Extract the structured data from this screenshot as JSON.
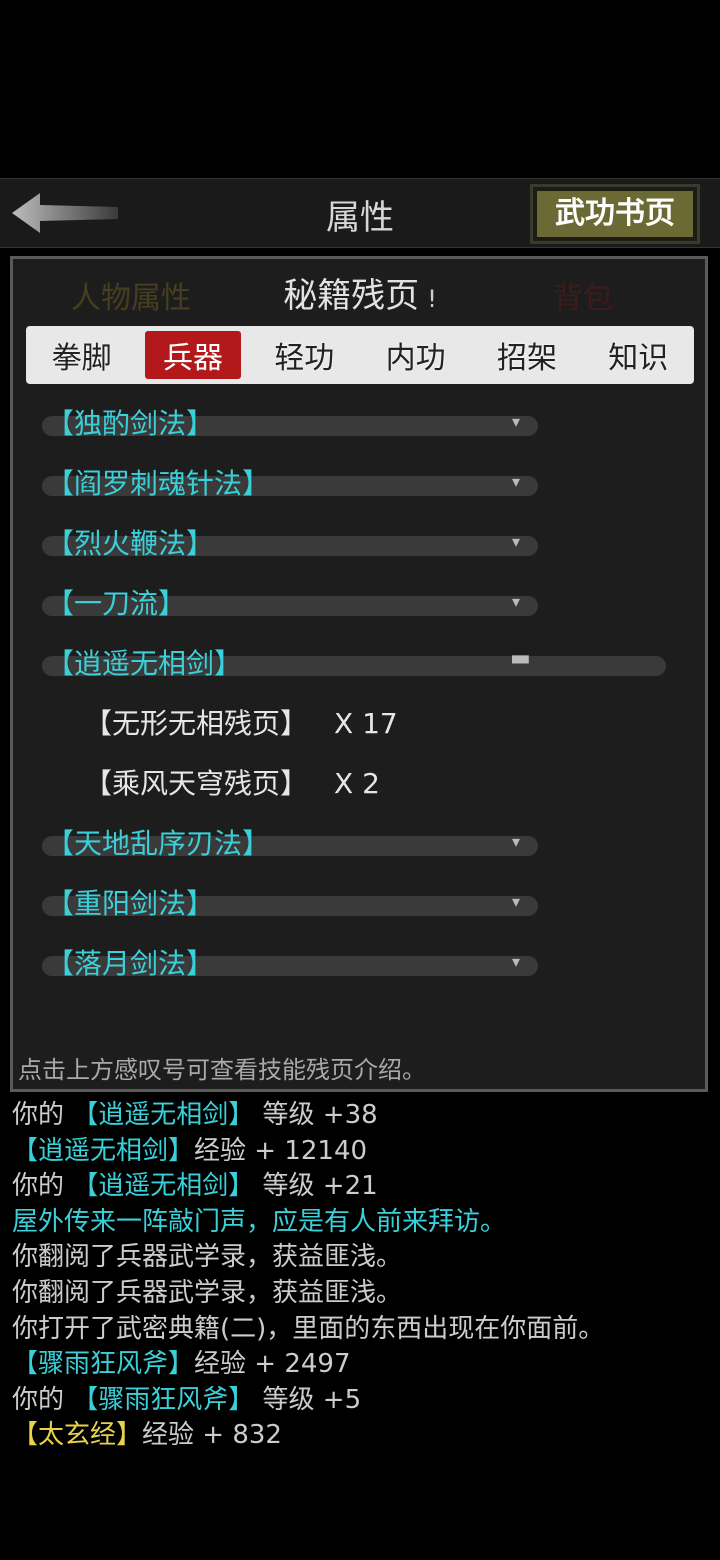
{
  "header": {
    "title": "属性",
    "back_icon": "back-arrow-icon",
    "action_button": "武功书页"
  },
  "background_panel": {
    "left_tab": "人物属性",
    "right_tab": "背包"
  },
  "modal": {
    "title": "秘籍残页",
    "info_mark": "!",
    "tabs": [
      {
        "label": "拳脚",
        "active": false
      },
      {
        "label": "兵器",
        "active": true
      },
      {
        "label": "轻功",
        "active": false
      },
      {
        "label": "内功",
        "active": false
      },
      {
        "label": "招架",
        "active": false
      },
      {
        "label": "知识",
        "active": false
      }
    ],
    "groups": [
      {
        "name": "【独酌剑法】",
        "state": "collapsed"
      },
      {
        "name": "【阎罗刺魂针法】",
        "state": "collapsed"
      },
      {
        "name": "【烈火鞭法】",
        "state": "collapsed"
      },
      {
        "name": "【一刀流】",
        "state": "collapsed"
      },
      {
        "name": "【逍遥无相剑】",
        "state": "expanded",
        "items": [
          {
            "name": "【无形无相残页】",
            "qty": "X 17"
          },
          {
            "name": "【乘风天穹残页】",
            "qty": "X 2"
          }
        ]
      },
      {
        "name": "【天地乱序刃法】",
        "state": "collapsed"
      },
      {
        "name": "【重阳剑法】",
        "state": "collapsed"
      },
      {
        "name": "【落月剑法】",
        "state": "collapsed"
      }
    ],
    "hint": "点击上方感叹号可查看技能残页介绍。"
  },
  "log": [
    [
      {
        "t": "你的 ",
        "c": ""
      },
      {
        "t": "【逍遥无相剑】",
        "c": "cyan"
      },
      {
        "t": " 等级 +38",
        "c": ""
      }
    ],
    [
      {
        "t": "【逍遥无相剑】",
        "c": "cyan"
      },
      {
        "t": "经验 + 12140",
        "c": ""
      }
    ],
    [
      {
        "t": "你的 ",
        "c": ""
      },
      {
        "t": "【逍遥无相剑】",
        "c": "cyan"
      },
      {
        "t": " 等级 +21",
        "c": ""
      }
    ],
    [
      {
        "t": "屋外传来一阵敲门声，应是有人前来拜访。",
        "c": "cyan"
      }
    ],
    [
      {
        "t": "你翻阅了兵器武学录，获益匪浅。",
        "c": ""
      }
    ],
    [
      {
        "t": "你翻阅了兵器武学录，获益匪浅。",
        "c": ""
      }
    ],
    [
      {
        "t": "你打开了武密典籍(二)，里面的东西出现在你面前。",
        "c": ""
      }
    ],
    [
      {
        "t": "【骤雨狂风斧】",
        "c": "cyan"
      },
      {
        "t": "经验 + 2497",
        "c": ""
      }
    ],
    [
      {
        "t": "你的 ",
        "c": ""
      },
      {
        "t": "【骤雨狂风斧】",
        "c": "cyan"
      },
      {
        "t": " 等级 +5",
        "c": ""
      }
    ],
    [
      {
        "t": "【太玄经】",
        "c": "yellow"
      },
      {
        "t": "经验 + 832",
        "c": ""
      }
    ]
  ]
}
